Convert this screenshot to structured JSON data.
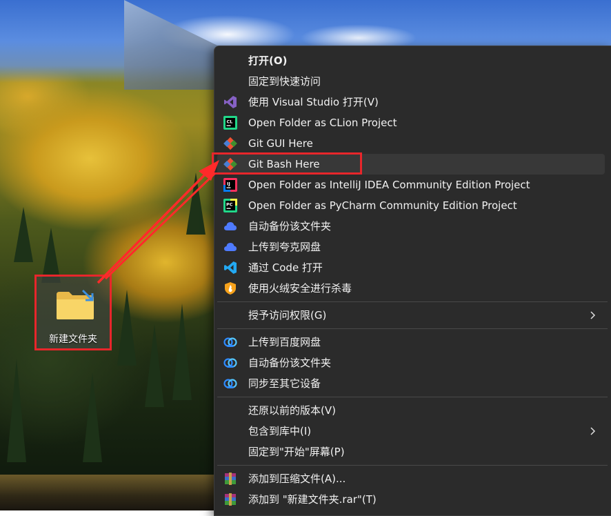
{
  "desktop": {
    "folder": {
      "label": "新建文件夹"
    }
  },
  "context_menu": {
    "items": [
      {
        "label": "打开(O)",
        "icon": "none"
      },
      {
        "label": "固定到快速访问",
        "icon": "none"
      },
      {
        "label": "使用 Visual Studio 打开(V)",
        "icon": "visual-studio-icon",
        "color": "#8661c5"
      },
      {
        "label": "Open Folder as CLion Project",
        "icon": "clion-icon",
        "color": "#21d789"
      },
      {
        "label": "Git GUI Here",
        "icon": "git-icon",
        "color": "#f05133"
      },
      {
        "label": "Git Bash Here",
        "icon": "git-icon",
        "color": "#f05133"
      },
      {
        "label": "Open Folder as IntelliJ IDEA Community Edition Project",
        "icon": "intellij-icon",
        "color": "#fe315d"
      },
      {
        "label": "Open Folder as PyCharm Community Edition Project",
        "icon": "pycharm-icon",
        "color": "#21d789"
      },
      {
        "label": "自动备份该文件夹",
        "icon": "cloud-icon",
        "color": "#4f7bff"
      },
      {
        "label": "上传到夸克网盘",
        "icon": "cloud-icon",
        "color": "#4f7bff"
      },
      {
        "label": "通过 Code 打开",
        "icon": "vscode-icon",
        "color": "#23a9f2"
      },
      {
        "label": "使用火绒安全进行杀毒",
        "icon": "shield-icon",
        "color": "#f7a21b"
      },
      {
        "label": "授予访问权限(G)",
        "icon": "none"
      },
      {
        "label": "上传到百度网盘",
        "icon": "baidu-cloud-icon",
        "color": "#2f8cff"
      },
      {
        "label": "自动备份该文件夹",
        "icon": "baidu-cloud-icon",
        "color": "#2f8cff"
      },
      {
        "label": "同步至其它设备",
        "icon": "baidu-cloud-icon",
        "color": "#2f8cff"
      },
      {
        "label": "还原以前的版本(V)",
        "icon": "none"
      },
      {
        "label": "包含到库中(I)",
        "icon": "none"
      },
      {
        "label": "固定到\"开始\"屏幕(P)",
        "icon": "none"
      },
      {
        "label": "添加到压缩文件(A)...",
        "icon": "winrar-icon",
        "color": "#a8327a"
      },
      {
        "label": "添加到 \"新建文件夹.rar\"(T)",
        "icon": "winrar-icon",
        "color": "#a8327a"
      }
    ]
  },
  "annotation": {
    "color": "#e8262b"
  }
}
